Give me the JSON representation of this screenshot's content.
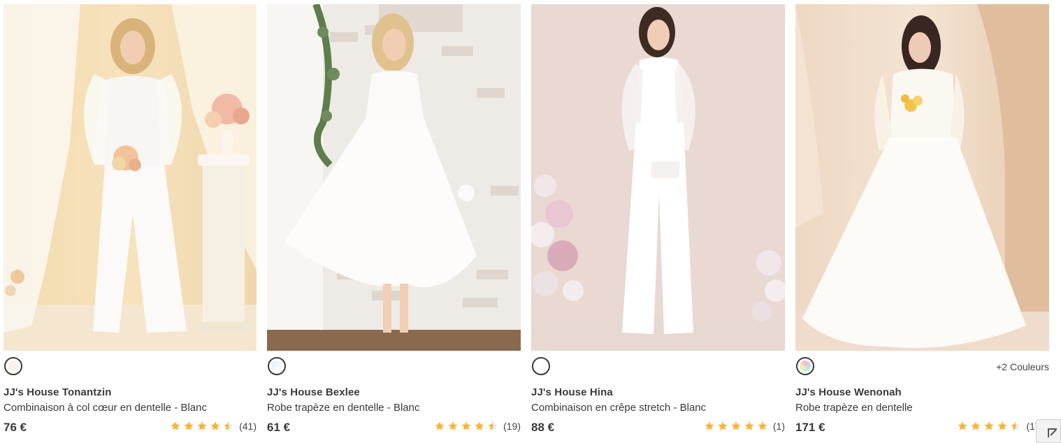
{
  "products": [
    {
      "title": "JJ's House Tonantzin",
      "subtitle": "Combinaison à col cœur en dentelle - Blanc",
      "price": "76 €",
      "rating": 4.5,
      "review_count": "(41)",
      "swatch_color": "#f7f4ef",
      "more_colors": ""
    },
    {
      "title": "JJ's House Bexlee",
      "subtitle": "Robe trapèze en dentelle - Blanc",
      "price": "61 €",
      "rating": 4.5,
      "review_count": "(19)",
      "swatch_color": "#f3f5f7",
      "more_colors": ""
    },
    {
      "title": "JJ's House Hina",
      "subtitle": "Combinaison en crêpe stretch - Blanc",
      "price": "88 €",
      "rating": 5,
      "review_count": "(1)",
      "swatch_color": "#ffffff",
      "more_colors": ""
    },
    {
      "title": "JJ's House Wenonah",
      "subtitle": "Robe trapèze en dentelle",
      "price": "171 €",
      "rating": 4.5,
      "review_count": "(175)",
      "swatch_color": "multicolor",
      "more_colors": "+2 Couleurs"
    }
  ],
  "colors": {
    "star": "#f4b63a",
    "text": "#3a3a3a"
  },
  "icons": {
    "star": "star-icon",
    "half_star": "half-star-icon",
    "widget": "expand-icon"
  }
}
